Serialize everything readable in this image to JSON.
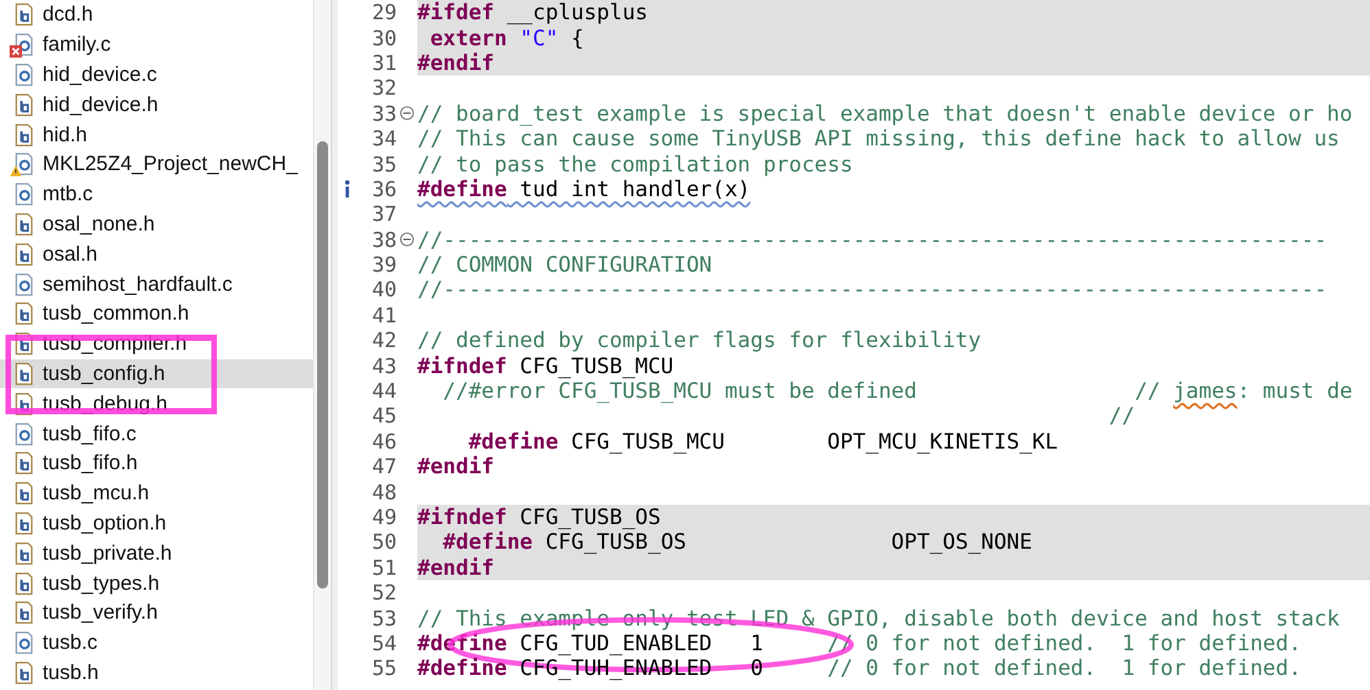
{
  "files": [
    {
      "name": "dcd.h",
      "kind": "h",
      "error": false,
      "warning": false,
      "selected": false,
      "circled": false
    },
    {
      "name": "family.c",
      "kind": "c",
      "error": true,
      "warning": false,
      "selected": false,
      "circled": false
    },
    {
      "name": "hid_device.c",
      "kind": "c",
      "error": false,
      "warning": false,
      "selected": false,
      "circled": false
    },
    {
      "name": "hid_device.h",
      "kind": "h",
      "error": false,
      "warning": false,
      "selected": false,
      "circled": false
    },
    {
      "name": "hid.h",
      "kind": "h",
      "error": false,
      "warning": false,
      "selected": false,
      "circled": false
    },
    {
      "name": "MKL25Z4_Project_newCH_",
      "kind": "c",
      "error": false,
      "warning": true,
      "selected": false,
      "circled": false
    },
    {
      "name": "mtb.c",
      "kind": "c",
      "error": false,
      "warning": false,
      "selected": false,
      "circled": false
    },
    {
      "name": "osal_none.h",
      "kind": "h",
      "error": false,
      "warning": false,
      "selected": false,
      "circled": false
    },
    {
      "name": "osal.h",
      "kind": "h",
      "error": false,
      "warning": false,
      "selected": false,
      "circled": false
    },
    {
      "name": "semihost_hardfault.c",
      "kind": "c",
      "error": false,
      "warning": false,
      "selected": false,
      "circled": false
    },
    {
      "name": "tusb_common.h",
      "kind": "h",
      "error": false,
      "warning": false,
      "selected": false,
      "circled": false
    },
    {
      "name": "tusb_compiler.h",
      "kind": "h",
      "error": false,
      "warning": false,
      "selected": false,
      "circled": false
    },
    {
      "name": "tusb_config.h",
      "kind": "h",
      "error": false,
      "warning": false,
      "selected": true,
      "circled": true
    },
    {
      "name": "tusb_debug.h",
      "kind": "h",
      "error": false,
      "warning": false,
      "selected": false,
      "circled": false
    },
    {
      "name": "tusb_fifo.c",
      "kind": "c",
      "error": false,
      "warning": false,
      "selected": false,
      "circled": false
    },
    {
      "name": "tusb_fifo.h",
      "kind": "h",
      "error": false,
      "warning": false,
      "selected": false,
      "circled": false
    },
    {
      "name": "tusb_mcu.h",
      "kind": "h",
      "error": false,
      "warning": false,
      "selected": false,
      "circled": false
    },
    {
      "name": "tusb_option.h",
      "kind": "h",
      "error": false,
      "warning": false,
      "selected": false,
      "circled": false
    },
    {
      "name": "tusb_private.h",
      "kind": "h",
      "error": false,
      "warning": false,
      "selected": false,
      "circled": false
    },
    {
      "name": "tusb_types.h",
      "kind": "h",
      "error": false,
      "warning": false,
      "selected": false,
      "circled": false
    },
    {
      "name": "tusb_verify.h",
      "kind": "h",
      "error": false,
      "warning": false,
      "selected": false,
      "circled": false
    },
    {
      "name": "tusb.c",
      "kind": "c",
      "error": false,
      "warning": false,
      "selected": false,
      "circled": false
    },
    {
      "name": "tusb.h",
      "kind": "h",
      "error": false,
      "warning": false,
      "selected": false,
      "circled": false
    }
  ],
  "code_lines": [
    {
      "number": "29",
      "highlighted": true,
      "fold": false,
      "info": false,
      "circled": false,
      "tokens": [
        {
          "kind": "keyword",
          "text": "#ifdef"
        },
        {
          "kind": "plain",
          "text": " __cplusplus"
        }
      ]
    },
    {
      "number": "30",
      "highlighted": true,
      "fold": false,
      "info": false,
      "circled": false,
      "tokens": [
        {
          "kind": "keyword",
          "text": " extern"
        },
        {
          "kind": "string",
          "text": " \"C\""
        },
        {
          "kind": "plain",
          "text": " {"
        }
      ]
    },
    {
      "number": "31",
      "highlighted": true,
      "fold": false,
      "info": false,
      "circled": false,
      "tokens": [
        {
          "kind": "keyword",
          "text": "#endif"
        }
      ]
    },
    {
      "number": "32",
      "highlighted": false,
      "fold": false,
      "info": false,
      "circled": false
    },
    {
      "number": "33",
      "highlighted": false,
      "fold": true,
      "info": false,
      "circled": false,
      "tokens": [
        {
          "kind": "comment",
          "text": "// board_test example is special example that doesn't enable device or ho"
        }
      ]
    },
    {
      "number": "34",
      "highlighted": false,
      "fold": false,
      "info": false,
      "circled": false,
      "tokens": [
        {
          "kind": "comment",
          "text": "// This can cause some TinyUSB API missing, this define hack to allow us"
        }
      ]
    },
    {
      "number": "35",
      "highlighted": false,
      "fold": false,
      "info": false,
      "circled": false,
      "tokens": [
        {
          "kind": "comment",
          "text": "// to pass the compilation process"
        }
      ]
    },
    {
      "number": "36",
      "highlighted": false,
      "fold": false,
      "info": true,
      "circled": false,
      "tokens": [
        {
          "kind": "keyword",
          "text": "#define",
          "info_underline": true
        },
        {
          "kind": "plain",
          "text": " tud int handler(x)",
          "info_underline": true
        }
      ]
    },
    {
      "number": "37",
      "highlighted": false,
      "fold": false,
      "info": false,
      "circled": false
    },
    {
      "number": "38",
      "highlighted": false,
      "fold": true,
      "info": false,
      "circled": false,
      "tokens": [
        {
          "kind": "comment",
          "text": "//---------------------------------------------------------------------"
        }
      ]
    },
    {
      "number": "39",
      "highlighted": false,
      "fold": false,
      "info": false,
      "circled": false,
      "tokens": [
        {
          "kind": "comment",
          "text": "// COMMON CONFIGURATION"
        }
      ]
    },
    {
      "number": "40",
      "highlighted": false,
      "fold": false,
      "info": false,
      "circled": false,
      "tokens": [
        {
          "kind": "comment",
          "text": "//---------------------------------------------------------------------"
        }
      ]
    },
    {
      "number": "41",
      "highlighted": false,
      "fold": false,
      "info": false,
      "circled": false
    },
    {
      "number": "42",
      "highlighted": false,
      "fold": false,
      "info": false,
      "circled": false,
      "tokens": [
        {
          "kind": "comment",
          "text": "// defined by compiler flags for flexibility"
        }
      ]
    },
    {
      "number": "43",
      "highlighted": false,
      "fold": false,
      "info": false,
      "circled": false,
      "tokens": [
        {
          "kind": "keyword",
          "text": "#ifndef"
        },
        {
          "kind": "plain",
          "text": " CFG_TUSB_MCU"
        }
      ]
    },
    {
      "number": "44",
      "highlighted": false,
      "fold": false,
      "info": false,
      "circled": false,
      "tokens": [
        {
          "kind": "comment",
          "text": "  //#error CFG_TUSB_MCU must be defined                 // "
        },
        {
          "kind": "comment",
          "text": "james",
          "misspelled": true
        },
        {
          "kind": "comment",
          "text": ": must de"
        }
      ]
    },
    {
      "number": "45",
      "highlighted": false,
      "fold": false,
      "info": false,
      "circled": false,
      "tokens": [
        {
          "kind": "comment",
          "text": "                                                      //"
        }
      ]
    },
    {
      "number": "46",
      "highlighted": false,
      "fold": false,
      "info": false,
      "circled": false,
      "tokens": [
        {
          "kind": "keyword",
          "text": "    #define"
        },
        {
          "kind": "plain",
          "text": " CFG_TUSB_MCU        OPT_MCU_KINETIS_KL"
        }
      ]
    },
    {
      "number": "47",
      "highlighted": false,
      "fold": false,
      "info": false,
      "circled": false,
      "tokens": [
        {
          "kind": "keyword",
          "text": "#endif"
        }
      ]
    },
    {
      "number": "48",
      "highlighted": false,
      "fold": false,
      "info": false,
      "circled": false
    },
    {
      "number": "49",
      "highlighted": true,
      "fold": false,
      "info": false,
      "circled": false,
      "tokens": [
        {
          "kind": "keyword",
          "text": "#ifndef"
        },
        {
          "kind": "plain",
          "text": " CFG_TUSB_OS"
        }
      ]
    },
    {
      "number": "50",
      "highlighted": true,
      "fold": false,
      "info": false,
      "circled": false,
      "tokens": [
        {
          "kind": "keyword",
          "text": "  #define"
        },
        {
          "kind": "plain",
          "text": " CFG_TUSB_OS                OPT_OS_NONE"
        }
      ]
    },
    {
      "number": "51",
      "highlighted": true,
      "fold": false,
      "info": false,
      "circled": false,
      "tokens": [
        {
          "kind": "keyword",
          "text": "#endif"
        }
      ]
    },
    {
      "number": "52",
      "highlighted": false,
      "fold": false,
      "info": false,
      "circled": false
    },
    {
      "number": "53",
      "highlighted": false,
      "fold": false,
      "info": false,
      "circled": false,
      "tokens": [
        {
          "kind": "comment",
          "text": "// This example only test LED & GPIO, disable both device and host stack"
        }
      ]
    },
    {
      "number": "54",
      "highlighted": false,
      "fold": false,
      "info": false,
      "circled": true,
      "tokens": [
        {
          "kind": "keyword",
          "text": "#define"
        },
        {
          "kind": "plain",
          "text": " CFG_TUD_ENABLED   1"
        },
        {
          "kind": "comment",
          "text": "     // 0 for not defined.  1 for defined."
        }
      ]
    },
    {
      "number": "55",
      "highlighted": false,
      "fold": false,
      "info": false,
      "circled": false,
      "tokens": [
        {
          "kind": "keyword",
          "text": "#define"
        },
        {
          "kind": "plain",
          "text": " CFG_TUH_ENABLED   0"
        },
        {
          "kind": "comment",
          "text": "     // 0 for not defined.  1 for defined."
        }
      ]
    }
  ]
}
